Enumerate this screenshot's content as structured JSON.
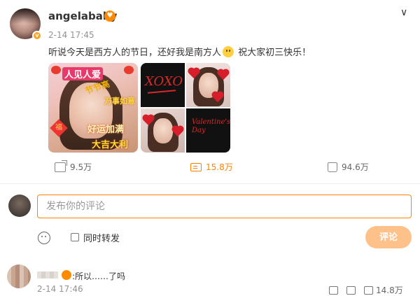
{
  "post": {
    "username": "angelababy",
    "timestamp": "2-14 17:45",
    "text_before_emoji": "听说今天是西方人的节日，还好我是南方人",
    "text_after_emoji": " 祝大家初三快乐！",
    "image1": {
      "captions": [
        "人见人爱",
        "节节高",
        "万事如意",
        "好运加满",
        "大吉大利",
        "福"
      ]
    },
    "image2": {
      "xoxo_text": "XOXO",
      "valentines_text": "Valentine's Day"
    }
  },
  "actions": {
    "share_count": "9.5万",
    "comment_count": "15.8万",
    "like_count": "94.6万"
  },
  "composer": {
    "placeholder": "发布你的评论",
    "repost_label": "同时转发",
    "submit_label": "评论"
  },
  "comment": {
    "text": ":所以……了吗",
    "timestamp": "2-14 17:46",
    "like_count": "14.8万"
  },
  "icons": {
    "verified": "verified-badge-icon",
    "chevron": "chevron-down-icon"
  },
  "colors": {
    "accent": "#ff8200",
    "submit_disabled": "#ffc18a"
  }
}
